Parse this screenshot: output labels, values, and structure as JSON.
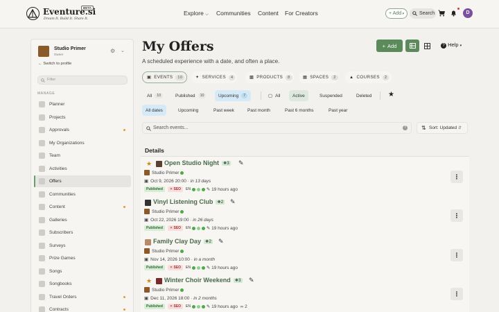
{
  "topbar": {
    "brand": "Eventure.si",
    "beta": "BETA",
    "tagline": "Dream It. Build It. Share It.",
    "nav": [
      "Explore",
      "Communities",
      "Content",
      "For Creators"
    ],
    "add_label": "+ Add",
    "search_label": "Search",
    "avatar_initial": "D"
  },
  "sidebar": {
    "org_name": "Studio Primer",
    "org_role": "Owner",
    "switch_label": "Switch to profile",
    "filter_placeholder": "Filter",
    "section_label": "MANAGE",
    "items": [
      {
        "label": "Planner",
        "dot": false
      },
      {
        "label": "Projects",
        "dot": false
      },
      {
        "label": "Approvals",
        "dot": true
      },
      {
        "label": "My Organizations",
        "dot": false
      },
      {
        "label": "Team",
        "dot": false
      },
      {
        "label": "Activities",
        "dot": false
      },
      {
        "label": "Offers",
        "dot": false
      },
      {
        "label": "Communities",
        "dot": false
      },
      {
        "label": "Content",
        "dot": true
      },
      {
        "label": "Galleries",
        "dot": false
      },
      {
        "label": "Subscribers",
        "dot": false
      },
      {
        "label": "Surveys",
        "dot": false
      },
      {
        "label": "Prize Games",
        "dot": false
      },
      {
        "label": "Songs",
        "dot": false
      },
      {
        "label": "Songbooks",
        "dot": false
      },
      {
        "label": "Travel Orders",
        "dot": true
      },
      {
        "label": "Contracts",
        "dot": true
      }
    ]
  },
  "main": {
    "title": "My Offers",
    "subtitle": "A scheduled experience with a date, and often a place.",
    "add_button": "Add",
    "help_label": "Help",
    "tabs": [
      {
        "label": "EVENTS",
        "count": "10"
      },
      {
        "label": "SERVICES",
        "count": "4"
      },
      {
        "label": "PRODUCTS",
        "count": "8"
      },
      {
        "label": "SPACES",
        "count": "2"
      },
      {
        "label": "COURSES",
        "count": "2"
      }
    ],
    "status_filters": [
      {
        "label": "All",
        "count": "10"
      },
      {
        "label": "Published",
        "count": "10"
      },
      {
        "label": "Upcoming",
        "count": "7"
      }
    ],
    "state_filters": [
      "All",
      "Active",
      "Suspended",
      "Deleted"
    ],
    "date_filters": [
      "All dates",
      "Upcoming",
      "Past week",
      "Past month",
      "Past 6 months",
      "Past year"
    ],
    "search_placeholder": "Search events...",
    "sort_label": "Sort: Updated",
    "details_title": "Details"
  },
  "events": [
    {
      "title": "Open Studio Night",
      "group_count": "3",
      "org": "Studio Primer",
      "date": "Oct 9, 2026 20:00",
      "relative": "in 13 days",
      "published": "Published",
      "seo": "✕ SEO",
      "lang": "EN",
      "updated": "19 hours ago",
      "starred": true,
      "views": ""
    },
    {
      "title": "Vinyl Listening Club",
      "group_count": "2",
      "org": "Studio Primer",
      "date": "Oct 22, 2026 19:00",
      "relative": "in 26 days",
      "published": "Published",
      "seo": "✕ SEO",
      "lang": "EN",
      "updated": "19 hours ago",
      "starred": false,
      "views": ""
    },
    {
      "title": "Family Clay Day",
      "group_count": "2",
      "org": "Studio Primer",
      "date": "Nov 14, 2026 10:00",
      "relative": "in a month",
      "published": "Published",
      "seo": "✕ SEO",
      "lang": "EN",
      "updated": "19 hours ago",
      "starred": false,
      "views": ""
    },
    {
      "title": "Winter Choir Weekend",
      "group_count": "3",
      "org": "Studio Primer",
      "date": "Dec 11, 2026 18:00",
      "relative": "in 2 months",
      "published": "Published",
      "seo": "✕ SEO",
      "lang": "EN",
      "updated": "19 hours ago",
      "starred": true,
      "views": "2"
    }
  ],
  "colors": {
    "accent": "#5b8a5b",
    "title_green": "#4a6a4a",
    "avatar": "#7b4ea2",
    "status_dot": "#e59b2b"
  }
}
